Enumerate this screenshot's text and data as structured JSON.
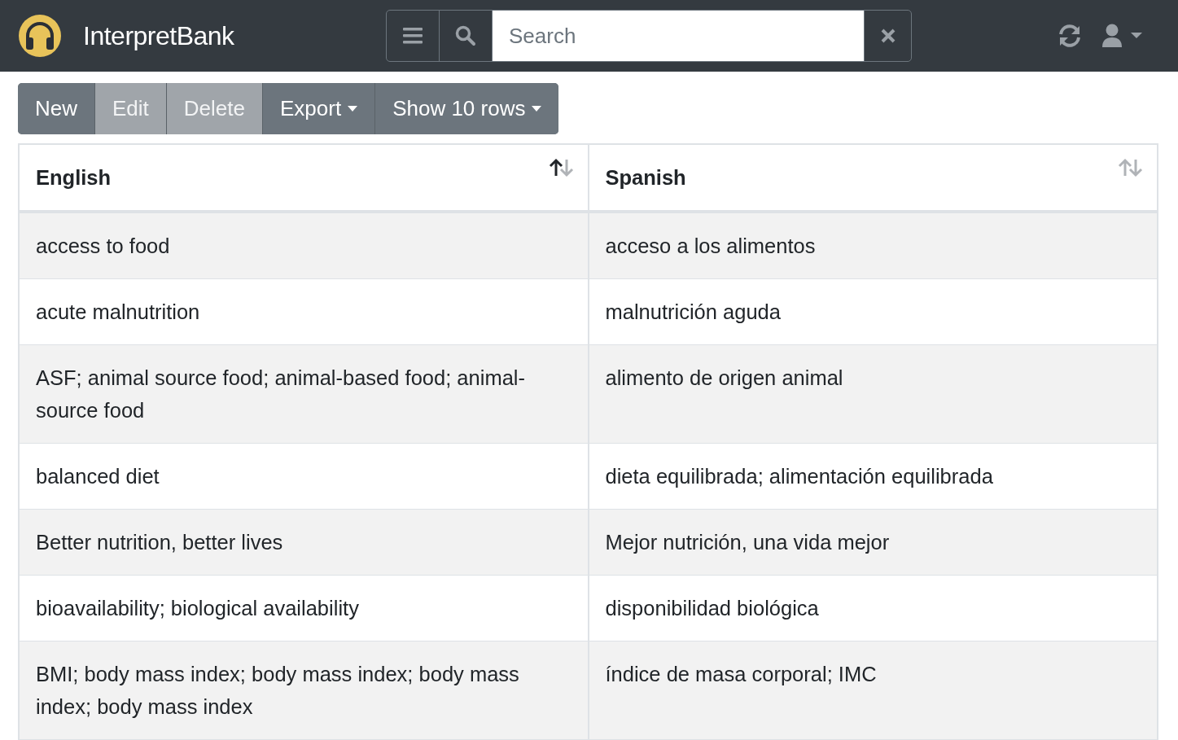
{
  "app": {
    "title": "InterpretBank"
  },
  "search": {
    "placeholder": "Search"
  },
  "toolbar": [
    {
      "label": "New",
      "kind": "button",
      "disabled": false
    },
    {
      "label": "Edit",
      "kind": "button",
      "disabled": true
    },
    {
      "label": "Delete",
      "kind": "button",
      "disabled": true
    },
    {
      "label": "Export",
      "kind": "dropdown",
      "disabled": false
    },
    {
      "label": "Show 10 rows",
      "kind": "dropdown",
      "disabled": false
    }
  ],
  "table": {
    "columns": [
      {
        "label": "English",
        "sorted_ascending": true,
        "sorted_descending": false
      },
      {
        "label": "Spanish",
        "sorted_ascending": false,
        "sorted_descending": false
      }
    ],
    "rows": [
      [
        "access to food",
        "acceso a los alimentos"
      ],
      [
        "acute malnutrition",
        "malnutrición aguda"
      ],
      [
        "ASF; animal source food; animal-based food; animal-source food",
        "alimento de origen animal"
      ],
      [
        "balanced diet",
        "dieta equilibrada; alimentación equilibrada"
      ],
      [
        "Better nutrition, better lives",
        "Mejor nutrición, una vida mejor"
      ],
      [
        "bioavailability; biological availability",
        "disponibilidad biológica"
      ],
      [
        "BMI; body mass index; body mass index; body mass index; body mass index",
        "índice de masa corporal; IMC"
      ]
    ]
  }
}
